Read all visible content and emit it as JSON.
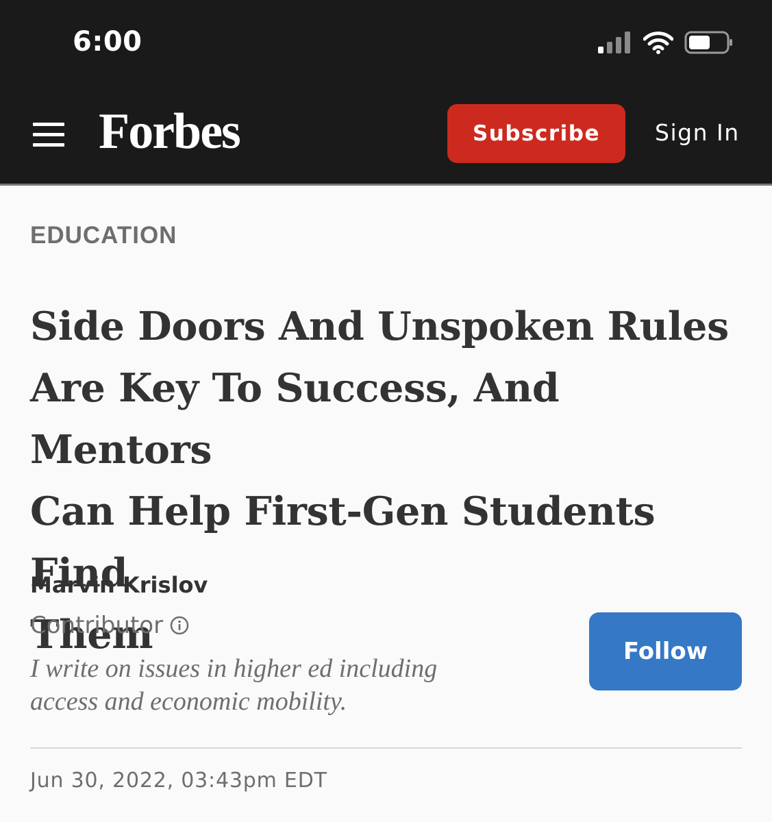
{
  "status_bar": {
    "time": "6:00",
    "icons": [
      "cellular-signal-icon",
      "wifi-icon",
      "battery-icon"
    ]
  },
  "header": {
    "logo": "Forbes",
    "subscribe_label": "Subscribe",
    "signin_label": "Sign In",
    "menu_icon": "hamburger-menu-icon"
  },
  "article": {
    "section": "EDUCATION",
    "headline_lines": [
      "Side Doors And Unspoken Rules",
      "Are Key To Success, And Mentors",
      "Can Help First-Gen Students Find",
      "Them"
    ],
    "author": {
      "name": "Marvin Krislov",
      "role": "Contributor",
      "bio_lines": [
        "I write on issues in higher ed including",
        "access and economic mobility."
      ],
      "follow_label": "Follow"
    },
    "date": "Jun 30, 2022, 03:43pm EDT"
  },
  "colors": {
    "header_bg": "#1a1a1a",
    "subscribe_bg": "#cc2a1e",
    "follow_bg": "#3578c6",
    "page_bg": "#fafafa",
    "muted_text": "#6e6e6e",
    "headline_text": "#333333"
  }
}
